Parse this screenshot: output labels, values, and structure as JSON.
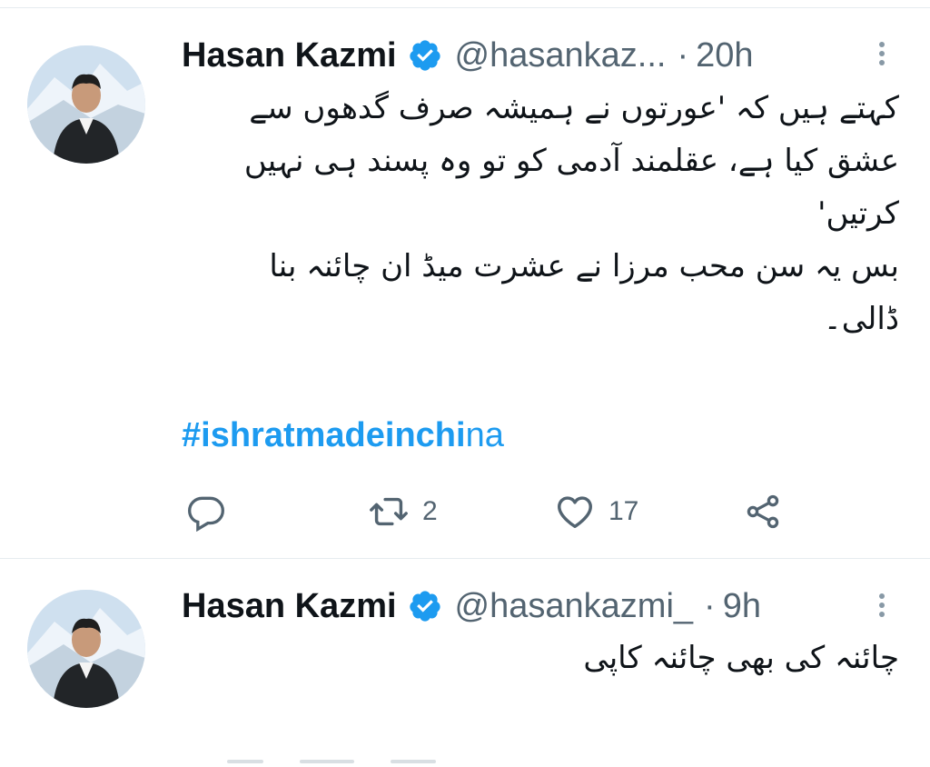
{
  "tweets": [
    {
      "author_name": "Hasan Kazmi",
      "handle": "@hasankaz...",
      "separator": "·",
      "time": "20h",
      "lines": [
        "کہتے ہیں کہ 'عورتوں نے ہمیشہ صرف گدھوں سے",
        "عشق کیا ہے، عقلمند آدمی کو تو وہ پسند ہی نہیں",
        "کرتیں'",
        "بس یہ سن محب مرزا نے عشرت میڈ ان چائنہ بنا",
        "ڈالی۔"
      ],
      "hashtag_bold": "#ishratmadeinchi",
      "hashtag_tail": "na",
      "retweet_count": "2",
      "like_count": "17"
    },
    {
      "author_name": "Hasan Kazmi",
      "handle": "@hasankazmi_",
      "separator": "·",
      "time": "9h",
      "lines": [
        "چائنہ کی بھی چائنہ کاپی"
      ]
    }
  ],
  "icons": {
    "verified": "verified-badge-icon",
    "more": "more-vertical-icon",
    "reply": "reply-icon",
    "retweet": "retweet-icon",
    "like": "heart-icon",
    "share": "share-icon"
  },
  "colors": {
    "accent": "#1d9bf0",
    "secondary_text": "#536471",
    "primary_text": "#0f1419",
    "divider": "#e6ecf0"
  }
}
